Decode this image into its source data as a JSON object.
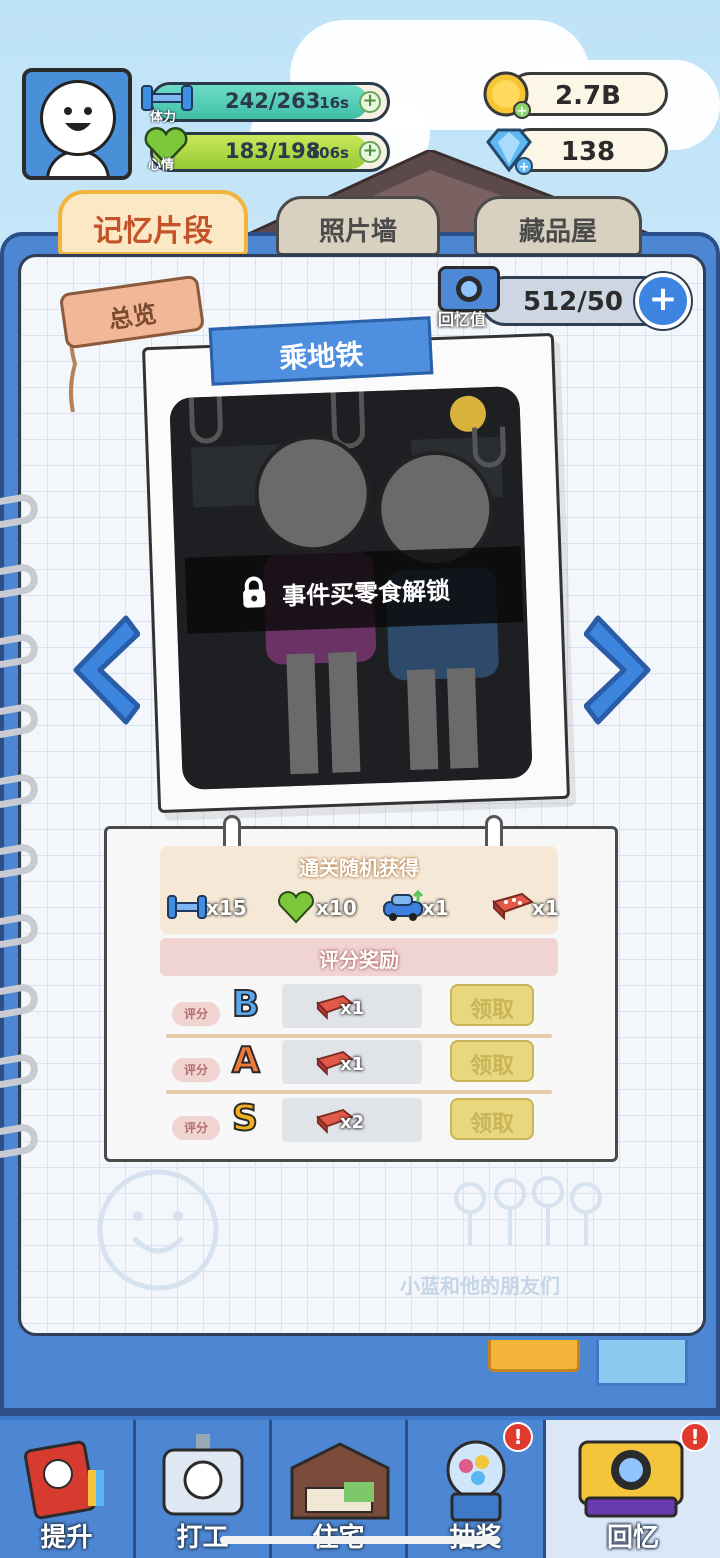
{
  "hud": {
    "stamina": {
      "label": "体力",
      "value": "242/263",
      "timer": "16s",
      "fill": 0.92
    },
    "mood": {
      "label": "心情",
      "value": "183/198",
      "timer": "106s",
      "fill": 0.92
    },
    "coins": "2.7B",
    "gems": "138"
  },
  "tabs": [
    {
      "label": "记忆片段",
      "active": true
    },
    {
      "label": "照片墙",
      "active": false
    },
    {
      "label": "藏品屋",
      "active": false
    }
  ],
  "overview_label": "总览",
  "memory": {
    "icon_label": "回忆值",
    "value": "512/50"
  },
  "photo": {
    "title": "乘地铁",
    "lock_text": "事件买零食解锁"
  },
  "drops": {
    "title": "通关随机获得",
    "items": [
      {
        "icon": "dumbbell-icon",
        "count": "x15"
      },
      {
        "icon": "heart-icon",
        "count": "x10"
      },
      {
        "icon": "car-icon",
        "count": "x1"
      },
      {
        "icon": "brick-icon",
        "count": "x1"
      }
    ]
  },
  "score_rewards": {
    "title": "评分奖励",
    "rows": [
      {
        "tag": "评分",
        "grade": "B",
        "grade_color": "#5aa9f0",
        "count": "x1",
        "claim": "领取"
      },
      {
        "tag": "评分",
        "grade": "A",
        "grade_color": "#f07a3a",
        "count": "x1",
        "claim": "领取"
      },
      {
        "tag": "评分",
        "grade": "S",
        "grade_color": "#f2b01e",
        "count": "x2",
        "claim": "领取"
      }
    ]
  },
  "watermark": "小蓝和他的朋友们",
  "nav": [
    {
      "label": "提升",
      "badge": ""
    },
    {
      "label": "打工",
      "badge": ""
    },
    {
      "label": "住宅",
      "badge": ""
    },
    {
      "label": "抽奖",
      "badge": "!"
    },
    {
      "label": "回忆",
      "badge": "!"
    }
  ]
}
